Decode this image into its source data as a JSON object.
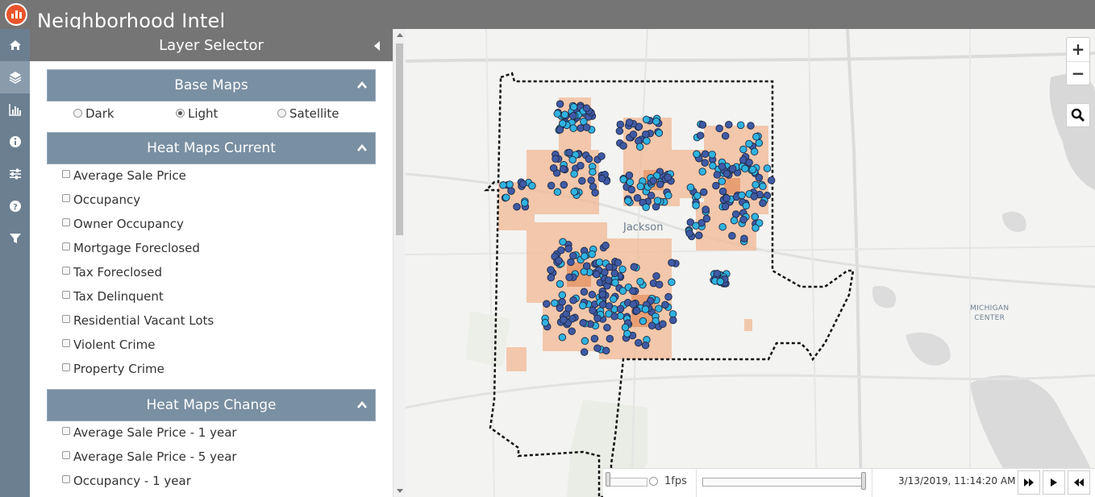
{
  "app": {
    "title": "Neighborhood Intel"
  },
  "rail": {
    "items": [
      {
        "icon": "home-icon"
      },
      {
        "icon": "layers-icon"
      },
      {
        "icon": "bar-chart-icon"
      },
      {
        "icon": "info-icon"
      },
      {
        "icon": "sliders-icon"
      },
      {
        "icon": "help-icon"
      },
      {
        "icon": "filter-icon"
      }
    ]
  },
  "panel": {
    "title": "Layer Selector",
    "base_maps": {
      "title": "Base Maps",
      "options": [
        "Dark",
        "Light",
        "Satellite"
      ],
      "selected": "Light"
    },
    "heat_current": {
      "title": "Heat Maps Current",
      "items": [
        "Average Sale Price",
        "Occupancy",
        "Owner Occupancy",
        "Mortgage Foreclosed",
        "Tax Foreclosed",
        "Tax Delinquent",
        "Residential Vacant Lots",
        "Violent Crime",
        "Property Crime"
      ]
    },
    "heat_change": {
      "title": "Heat Maps Change",
      "items": [
        "Average Sale Price - 1 year",
        "Average Sale Price - 5 year",
        "Occupancy - 1 year"
      ]
    }
  },
  "map": {
    "city_label": "Jackson",
    "place_label_line1": "MICHIGAN",
    "place_label_line2": "CENTER",
    "zoom_in": "+",
    "zoom_out": "−",
    "colors": {
      "dark_point": "#3f5aa6",
      "light_point": "#2fb3e0",
      "heat": "#f2b994",
      "boundary": "#111111"
    }
  },
  "timeline": {
    "fps": "1fps",
    "timestamp": "3/13/2019, 11:14:20 AM"
  }
}
